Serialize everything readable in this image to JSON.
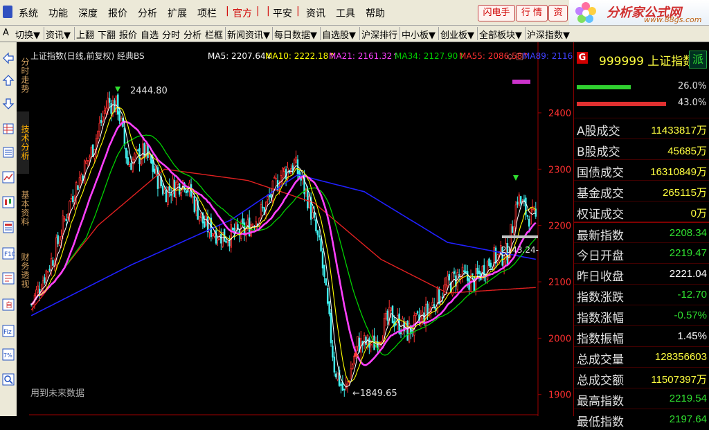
{
  "menu": {
    "items": [
      "系统",
      "功能",
      "深度",
      "报价",
      "分析",
      "扩展",
      "项栏"
    ],
    "official": "官方",
    "pingan": "平安",
    "more": [
      "资讯",
      "工具",
      "帮助"
    ],
    "buttons": [
      "闪电手",
      "行 情",
      "资"
    ]
  },
  "brand": {
    "title": "分析家公式网",
    "url": "www.88gs.com"
  },
  "toolbar": [
    "A",
    "切换▼",
    "资讯▼",
    "上翻",
    "下翻",
    "报价",
    "自选",
    "分时",
    "分析",
    "栏框",
    "新闻资讯▼",
    "每日数据▼",
    "自选股▼",
    "沪深排行",
    "中小板▼",
    "创业板▼",
    "全部板块▼",
    "沪深指数▼"
  ],
  "vtabs": [
    "分时走势",
    "技术分析",
    "基本资料",
    "财务透视"
  ],
  "chart": {
    "header_prefix": "上证指数(日线,前复权) 经典BS",
    "ma_labels": [
      {
        "text": "MA5: 2207.64↓",
        "color": "#ffffff"
      },
      {
        "text": "MA10: 2222.18↑",
        "color": "#ffff00"
      },
      {
        "text": "MA21: 2161.32↑",
        "color": "#ff40ff"
      },
      {
        "text": "MA34: 2127.90↑",
        "color": "#00d000"
      },
      {
        "text": "MA55: 2086.58↑",
        "color": "#ff3030"
      },
      {
        "text": "MA89: 2116",
        "color": "#4040ff"
      }
    ],
    "y_ticks": [
      2400,
      2300,
      2200,
      2100,
      2000,
      1900
    ],
    "ylim": [
      1880,
      2470
    ],
    "high_label": "2444.80",
    "low_label": "←1849.65",
    "current_label": "2143.24-",
    "footer_note": "用到未来数据",
    "colors": {
      "up": "#ff3030",
      "down": "#40f0f0",
      "ma5": "#ffffff",
      "ma10": "#ffff00",
      "ma21": "#ff40ff",
      "ma34": "#00d000",
      "ma55": "#e02020",
      "ma89": "#2020ff"
    },
    "anchors": [
      [
        0,
        2060
      ],
      [
        14,
        2150
      ],
      [
        24,
        2250
      ],
      [
        36,
        2330
      ],
      [
        46,
        2420
      ],
      [
        52,
        2410
      ],
      [
        58,
        2310
      ],
      [
        68,
        2330
      ],
      [
        80,
        2260
      ],
      [
        92,
        2280
      ],
      [
        104,
        2200
      ],
      [
        116,
        2180
      ],
      [
        128,
        2190
      ],
      [
        140,
        2230
      ],
      [
        150,
        2290
      ],
      [
        158,
        2310
      ],
      [
        166,
        2250
      ],
      [
        174,
        2150
      ],
      [
        182,
        1950
      ],
      [
        188,
        1900
      ],
      [
        196,
        1990
      ],
      [
        206,
        1990
      ],
      [
        216,
        2040
      ],
      [
        226,
        2010
      ],
      [
        236,
        2040
      ],
      [
        246,
        2080
      ],
      [
        256,
        2110
      ],
      [
        266,
        2100
      ],
      [
        276,
        2140
      ],
      [
        286,
        2150
      ],
      [
        292,
        2250
      ],
      [
        298,
        2220
      ],
      [
        303,
        2210
      ]
    ],
    "ma89_pts": [
      [
        0,
        2040
      ],
      [
        60,
        2130
      ],
      [
        120,
        2210
      ],
      [
        160,
        2290
      ],
      [
        200,
        2260
      ],
      [
        250,
        2170
      ],
      [
        303,
        2140
      ]
    ],
    "ma55_pts": [
      [
        0,
        2050
      ],
      [
        40,
        2200
      ],
      [
        80,
        2300
      ],
      [
        130,
        2280
      ],
      [
        170,
        2240
      ],
      [
        210,
        2140
      ],
      [
        250,
        2080
      ],
      [
        303,
        2090
      ]
    ]
  },
  "quote": {
    "badge": "G",
    "code_name": "999999 上证指数",
    "pai": "派",
    "bars": [
      {
        "pct": "26.0%",
        "fill": 0.26
      },
      {
        "pct": "43.0%",
        "fill": 0.43
      }
    ],
    "rows": [
      {
        "label": "A股成交",
        "value": "11433817万",
        "color": "#ffff40"
      },
      {
        "label": "B股成交",
        "value": "45685万",
        "color": "#ffff40"
      },
      {
        "label": "国债成交",
        "value": "16310849万",
        "color": "#ffff40"
      },
      {
        "label": "基金成交",
        "value": "265115万",
        "color": "#ffff40"
      },
      {
        "label": "权证成交",
        "value": "0万",
        "color": "#ffff40"
      },
      {
        "label": "最新指数",
        "value": "2208.34",
        "color": "#30e030"
      },
      {
        "label": "今日开盘",
        "value": "2219.47",
        "color": "#30e030"
      },
      {
        "label": "昨日收盘",
        "value": "2221.04",
        "color": "#ffffff"
      },
      {
        "label": "指数涨跌",
        "value": "-12.70",
        "color": "#30e030"
      },
      {
        "label": "指数涨幅",
        "value": "-0.57%",
        "color": "#30e030"
      },
      {
        "label": "指数振幅",
        "value": "1.45%",
        "color": "#ffffff"
      },
      {
        "label": "总成交量",
        "value": "128356603",
        "color": "#ffff40"
      },
      {
        "label": "总成交额",
        "value": "11507397万",
        "color": "#ffff40"
      },
      {
        "label": "最高指数",
        "value": "2219.54",
        "color": "#30e030"
      },
      {
        "label": "最低指数",
        "value": "2197.64",
        "color": "#30e030"
      }
    ]
  }
}
